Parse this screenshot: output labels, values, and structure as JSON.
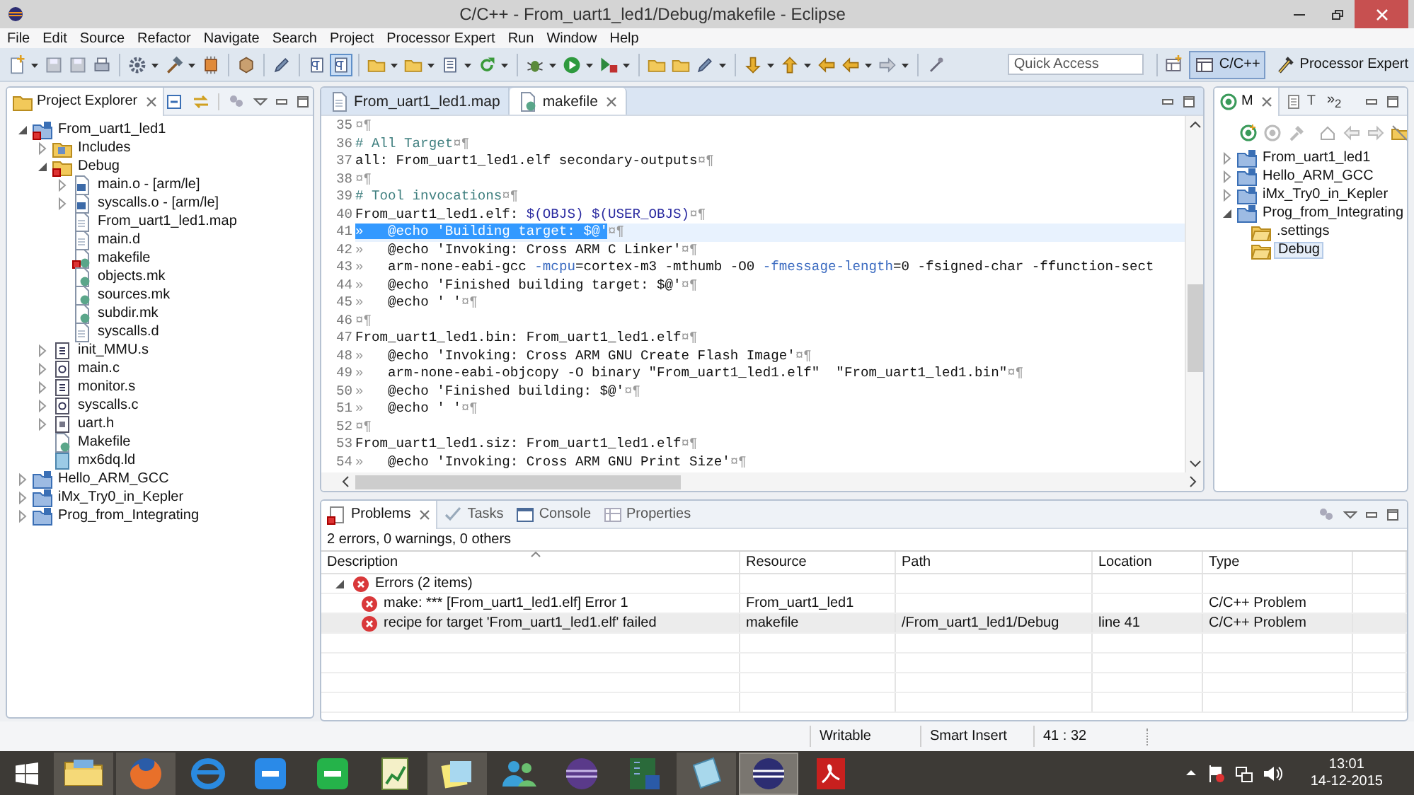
{
  "window": {
    "title": "C/C++ - From_uart1_led1/Debug/makefile - Eclipse"
  },
  "menu": [
    "File",
    "Edit",
    "Source",
    "Refactor",
    "Navigate",
    "Search",
    "Project",
    "Processor Expert",
    "Run",
    "Window",
    "Help"
  ],
  "toolbar": {
    "toggles": [
      {
        "on": false
      },
      {
        "on": true
      }
    ],
    "quick_access": {
      "placeholder": "Quick Access"
    },
    "perspectives": [
      {
        "label": "C/C++",
        "selected": true
      },
      {
        "label": "Processor Expert",
        "selected": false
      }
    ]
  },
  "project_explorer": {
    "title": "Project Explorer",
    "items": [
      {
        "label": "From_uart1_led1",
        "kind": "project",
        "error": true,
        "expanded": true,
        "children": [
          {
            "label": "Includes",
            "kind": "includes",
            "expanded": false
          },
          {
            "label": "Debug",
            "kind": "folder",
            "error": true,
            "expanded": true,
            "children": [
              {
                "label": "main.o - [arm/le]",
                "kind": "binary",
                "expanded": false
              },
              {
                "label": "syscalls.o - [arm/le]",
                "kind": "binary",
                "expanded": false
              },
              {
                "label": "From_uart1_led1.map",
                "kind": "file"
              },
              {
                "label": "main.d",
                "kind": "file"
              },
              {
                "label": "makefile",
                "kind": "makefile",
                "error": true
              },
              {
                "label": "objects.mk",
                "kind": "makefile"
              },
              {
                "label": "sources.mk",
                "kind": "makefile"
              },
              {
                "label": "subdir.mk",
                "kind": "makefile"
              },
              {
                "label": "syscalls.d",
                "kind": "file"
              }
            ]
          },
          {
            "label": "init_MMU.s",
            "kind": "asm",
            "expanded": false
          },
          {
            "label": "main.c",
            "kind": "c",
            "expanded": false
          },
          {
            "label": "monitor.s",
            "kind": "asm",
            "expanded": false
          },
          {
            "label": "syscalls.c",
            "kind": "c",
            "expanded": false
          },
          {
            "label": "uart.h",
            "kind": "h",
            "expanded": false
          },
          {
            "label": "Makefile",
            "kind": "makefile"
          },
          {
            "label": "mx6dq.ld",
            "kind": "ld"
          }
        ]
      },
      {
        "label": "Hello_ARM_GCC",
        "kind": "project",
        "expanded": false
      },
      {
        "label": "iMx_Try0_in_Kepler",
        "kind": "project",
        "expanded": false
      },
      {
        "label": "Prog_from_Integrating",
        "kind": "project",
        "expanded": false
      }
    ]
  },
  "editor": {
    "tabs": [
      {
        "label": "From_uart1_led1.map",
        "kind": "file",
        "selected": false
      },
      {
        "label": "makefile",
        "kind": "makefile",
        "selected": true
      }
    ],
    "lines": [
      {
        "number": "35",
        "tokens": [
          {
            "kind": "whitespace",
            "text": "¤¶"
          }
        ]
      },
      {
        "number": "36",
        "tokens": [
          {
            "kind": "comment",
            "text": "# All Target"
          },
          {
            "kind": "whitespace",
            "text": "¤¶"
          }
        ]
      },
      {
        "number": "37",
        "tokens": [
          {
            "kind": "plain",
            "text": "all: From_uart1_led1.elf secondary-outputs"
          },
          {
            "kind": "whitespace",
            "text": "¤¶"
          }
        ]
      },
      {
        "number": "38",
        "tokens": [
          {
            "kind": "whitespace",
            "text": "¤¶"
          }
        ]
      },
      {
        "number": "39",
        "tokens": [
          {
            "kind": "comment",
            "text": "# Tool invocations"
          },
          {
            "kind": "whitespace",
            "text": "¤¶"
          }
        ]
      },
      {
        "number": "40",
        "tokens": [
          {
            "kind": "plain",
            "text": "From_uart1_led1.elf: "
          },
          {
            "kind": "variable",
            "text": "$(OBJS) $(USER_OBJS)"
          },
          {
            "kind": "whitespace",
            "text": "¤¶"
          }
        ]
      },
      {
        "number": "41",
        "current": true,
        "tokens": [
          {
            "kind": "selection",
            "text": "»   @echo 'Building target: $@'"
          },
          {
            "kind": "whitespace",
            "text": "¤¶"
          }
        ]
      },
      {
        "number": "42",
        "tokens": [
          {
            "kind": "whitespace",
            "text": "»"
          },
          {
            "kind": "plain",
            "text": "   @echo 'Invoking: Cross ARM C Linker'"
          },
          {
            "kind": "whitespace",
            "text": "¤¶"
          }
        ]
      },
      {
        "number": "43",
        "tokens": [
          {
            "kind": "whitespace",
            "text": "»"
          },
          {
            "kind": "plain",
            "text": "   arm-none-eabi-gcc "
          },
          {
            "kind": "option",
            "text": "-mcpu"
          },
          {
            "kind": "plain",
            "text": "=cortex-m3 -mthumb -O0 "
          },
          {
            "kind": "option",
            "text": "-fmessage-length"
          },
          {
            "kind": "plain",
            "text": "=0 -fsigned-char -ffunction-sect"
          }
        ]
      },
      {
        "number": "44",
        "tokens": [
          {
            "kind": "whitespace",
            "text": "»"
          },
          {
            "kind": "plain",
            "text": "   @echo 'Finished building target: $@'"
          },
          {
            "kind": "whitespace",
            "text": "¤¶"
          }
        ]
      },
      {
        "number": "45",
        "tokens": [
          {
            "kind": "whitespace",
            "text": "»"
          },
          {
            "kind": "plain",
            "text": "   @echo ' '"
          },
          {
            "kind": "whitespace",
            "text": "¤¶"
          }
        ]
      },
      {
        "number": "46",
        "tokens": [
          {
            "kind": "whitespace",
            "text": "¤¶"
          }
        ]
      },
      {
        "number": "47",
        "tokens": [
          {
            "kind": "plain",
            "text": "From_uart1_led1.bin: From_uart1_led1.elf"
          },
          {
            "kind": "whitespace",
            "text": "¤¶"
          }
        ]
      },
      {
        "number": "48",
        "tokens": [
          {
            "kind": "whitespace",
            "text": "»"
          },
          {
            "kind": "plain",
            "text": "   @echo 'Invoking: Cross ARM GNU Create Flash Image'"
          },
          {
            "kind": "whitespace",
            "text": "¤¶"
          }
        ]
      },
      {
        "number": "49",
        "tokens": [
          {
            "kind": "whitespace",
            "text": "»"
          },
          {
            "kind": "plain",
            "text": "   arm-none-eabi-objcopy -O binary \"From_uart1_led1.elf\"  \"From_uart1_led1.bin\""
          },
          {
            "kind": "whitespace",
            "text": "¤¶"
          }
        ]
      },
      {
        "number": "50",
        "tokens": [
          {
            "kind": "whitespace",
            "text": "»"
          },
          {
            "kind": "plain",
            "text": "   @echo 'Finished building: $@'"
          },
          {
            "kind": "whitespace",
            "text": "¤¶"
          }
        ]
      },
      {
        "number": "51",
        "tokens": [
          {
            "kind": "whitespace",
            "text": "»"
          },
          {
            "kind": "plain",
            "text": "   @echo ' '"
          },
          {
            "kind": "whitespace",
            "text": "¤¶"
          }
        ]
      },
      {
        "number": "52",
        "tokens": [
          {
            "kind": "whitespace",
            "text": "¤¶"
          }
        ]
      },
      {
        "number": "53",
        "tokens": [
          {
            "kind": "plain",
            "text": "From_uart1_led1.siz: From_uart1_led1.elf"
          },
          {
            "kind": "whitespace",
            "text": "¤¶"
          }
        ]
      },
      {
        "number": "54",
        "tokens": [
          {
            "kind": "whitespace",
            "text": "»"
          },
          {
            "kind": "plain",
            "text": "   @echo 'Invoking: Cross ARM GNU Print Size'"
          },
          {
            "kind": "whitespace",
            "text": "¤¶"
          }
        ]
      }
    ]
  },
  "side_view": {
    "tabs": [
      {
        "label": "M",
        "kind": "make",
        "selected": true
      },
      {
        "label": "T",
        "kind": "page",
        "selected": false
      }
    ],
    "overflow": "»$_{2}$",
    "items": [
      {
        "label": "From_uart1_led1",
        "kind": "project",
        "expanded": false,
        "selected": false
      },
      {
        "label": "Hello_ARM_GCC",
        "kind": "project",
        "expanded": false,
        "selected": false
      },
      {
        "label": "iMx_Try0_in_Kepler",
        "kind": "project",
        "expanded": false,
        "selected": false
      },
      {
        "label": "Prog_from_Integrating",
        "kind": "project",
        "expanded": true,
        "selected": false,
        "children": [
          {
            "label": ".settings",
            "kind": "openfolder",
            "selected": false
          },
          {
            "label": "Debug",
            "kind": "openfolder",
            "selected": true
          }
        ]
      }
    ]
  },
  "problems": {
    "tabs": [
      {
        "label": "Problems",
        "kind": "problems",
        "selected": true
      },
      {
        "label": "Tasks",
        "kind": "tasks",
        "selected": false
      },
      {
        "label": "Console",
        "kind": "console",
        "selected": false
      },
      {
        "label": "Properties",
        "kind": "properties",
        "selected": false
      }
    ],
    "summary": "2 errors, 0 warnings, 0 others",
    "columns": [
      "Description",
      "Resource",
      "Path",
      "Location",
      "Type"
    ],
    "groups": [
      {
        "label": "Errors (2 items)",
        "expanded": true,
        "rows": [
          {
            "description": "make: *** [From_uart1_led1.elf] Error 1",
            "resource": "From_uart1_led1",
            "path": "",
            "location": "",
            "type": "C/C++ Problem",
            "selected": false
          },
          {
            "description": "recipe for target 'From_uart1_led1.elf' failed",
            "resource": "makefile",
            "path": "/From_uart1_led1/Debug",
            "location": "line 41",
            "type": "C/C++ Problem",
            "selected": true
          }
        ]
      }
    ]
  },
  "status_bar": [
    "Writable",
    "Smart Insert",
    "41 : 32"
  ],
  "taskbar": {
    "apps": [
      {
        "kind": "folder",
        "running": true,
        "selected": false
      },
      {
        "kind": "fox",
        "running": true,
        "selected": false
      },
      {
        "kind": "ring",
        "running": false,
        "selected": false
      },
      {
        "kind": "tile-blue",
        "running": false,
        "selected": false
      },
      {
        "kind": "tile-green",
        "running": false,
        "selected": false
      },
      {
        "kind": "chart",
        "running": false,
        "selected": false
      },
      {
        "kind": "notes",
        "running": true,
        "selected": false
      },
      {
        "kind": "people",
        "running": false,
        "selected": false
      },
      {
        "kind": "orb-purple",
        "running": false,
        "selected": false
      },
      {
        "kind": "chip",
        "running": false,
        "selected": false
      },
      {
        "kind": "notepad",
        "running": true,
        "selected": false
      },
      {
        "kind": "orb-blue",
        "running": true,
        "selected": true
      },
      {
        "kind": "pdf",
        "running": false,
        "selected": false
      }
    ],
    "time": "13:01",
    "date": "14-12-2015"
  }
}
